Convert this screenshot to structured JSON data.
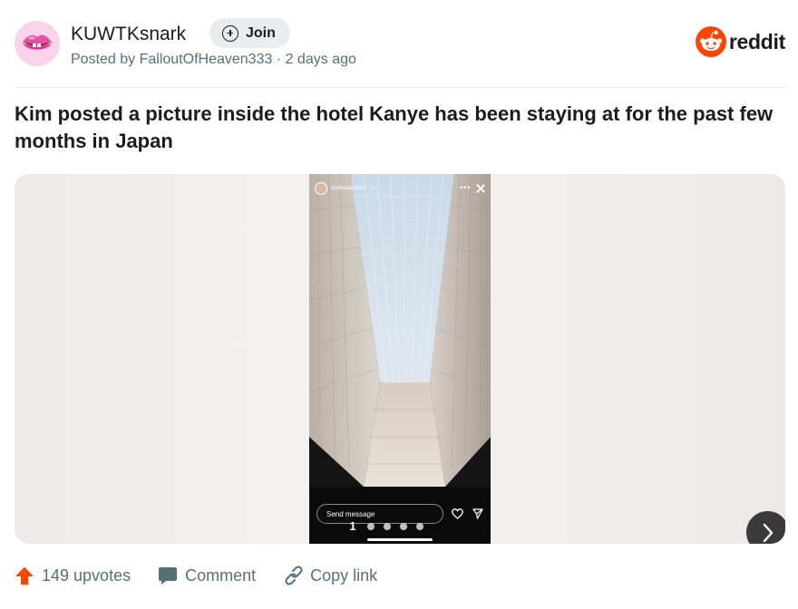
{
  "post": {
    "subreddit": "KUWTKsnark",
    "join_label": "Join",
    "posted_by": "Posted by FalloutOfHeaven333 · 2 days ago",
    "brand": "reddit",
    "title": "Kim posted a picture inside the hotel Kanye has been staying at for the past few months in Japan"
  },
  "story": {
    "username": "kimkardashian",
    "time": "3h",
    "send_placeholder": "Send message",
    "current_page": "1",
    "dots_count": 4
  },
  "actions": {
    "upvotes": "149 upvotes",
    "comment": "Comment",
    "copy_link": "Copy link"
  },
  "icons": {
    "avatar": "lips-avatar-icon",
    "join": "plus-circle-icon",
    "brand": "reddit-alien-icon",
    "next": "chevron-right-icon",
    "upvote": "upvote-arrow-icon",
    "comment": "speech-bubble-icon",
    "copy_link": "chain-link-icon"
  },
  "colors": {
    "brand_orange": "#ff4500",
    "meta_gray": "#576f76",
    "join_bg": "#e8ecef",
    "upvote_orange": "#ff4500"
  }
}
